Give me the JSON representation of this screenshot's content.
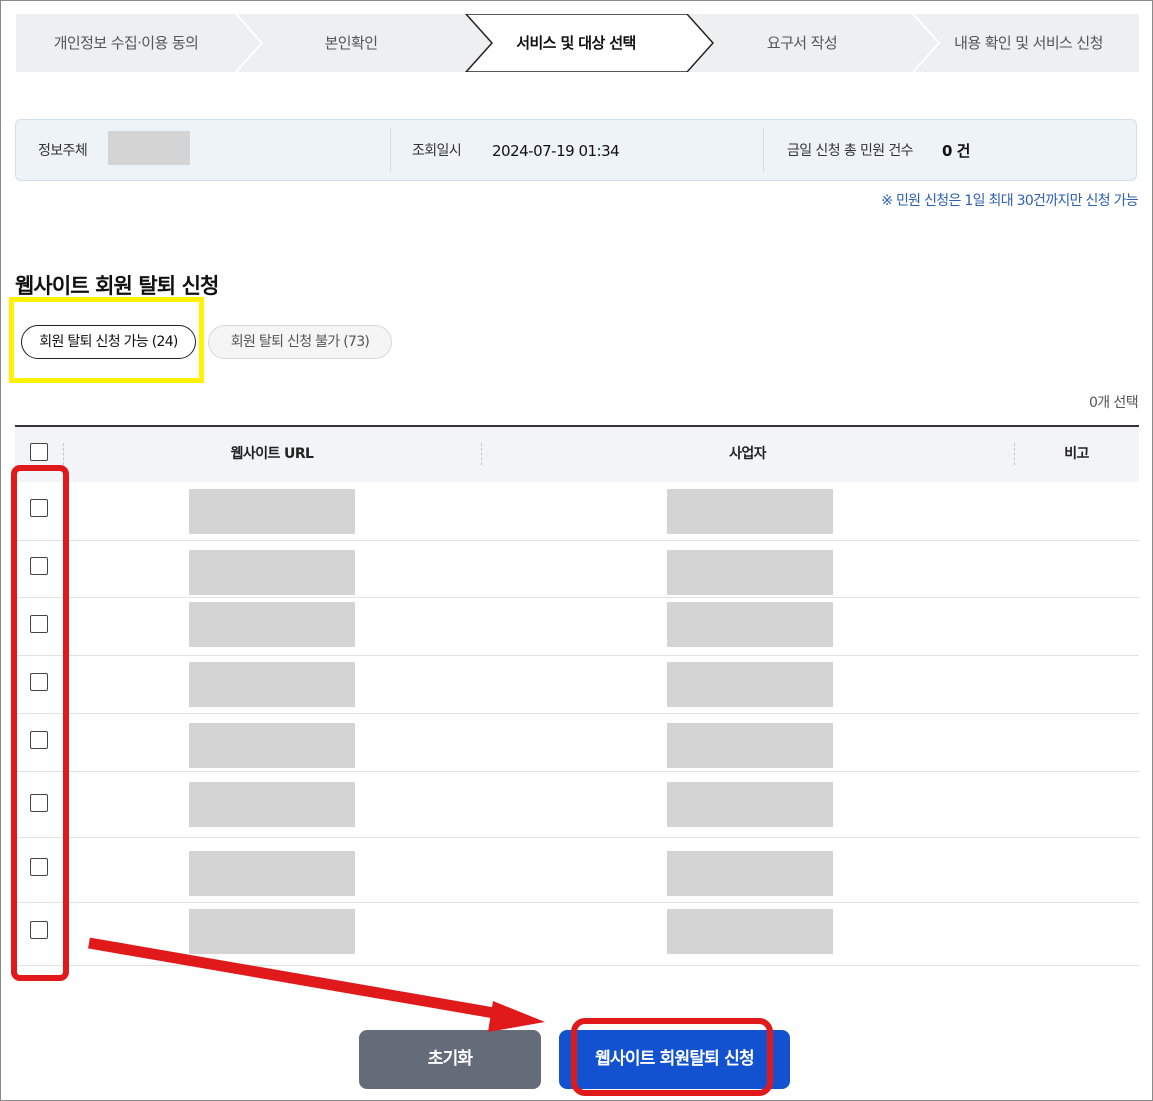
{
  "steps": [
    {
      "label": "개인정보 수집·이용 동의",
      "active": false
    },
    {
      "label": "본인확인",
      "active": false
    },
    {
      "label": "서비스 및 대상 선택",
      "active": true
    },
    {
      "label": "요구서 작성",
      "active": false
    },
    {
      "label": "내용 확인 및 서비스 신청",
      "active": false
    }
  ],
  "info": {
    "subject_label": "정보주체",
    "query_label": "조회일시",
    "query_value": "2024-07-19 01:34",
    "total_label": "금일 신청 총 민원 건수",
    "total_value": "0 건"
  },
  "notice": "※ 민원 신청은 1일 최대 30건까지만 신청 가능",
  "section_title": "웹사이트 회원 탈퇴 신청",
  "tabs": {
    "available": "회원 탈퇴 신청 가능 (24)",
    "unavailable": "회원 탈퇴 신청 불가 (73)"
  },
  "selected_count": "0개 선택",
  "table": {
    "headers": {
      "url": "웹사이트 URL",
      "company": "사업자",
      "note": "비고"
    },
    "row_count": 8
  },
  "buttons": {
    "reset": "초기화",
    "submit": "웹사이트 회원탈퇴 신청"
  },
  "colors": {
    "annotation_red": "#e01a1a",
    "annotation_yellow": "#fff200",
    "submit_blue": "#1252d1",
    "reset_gray": "#656c79"
  }
}
